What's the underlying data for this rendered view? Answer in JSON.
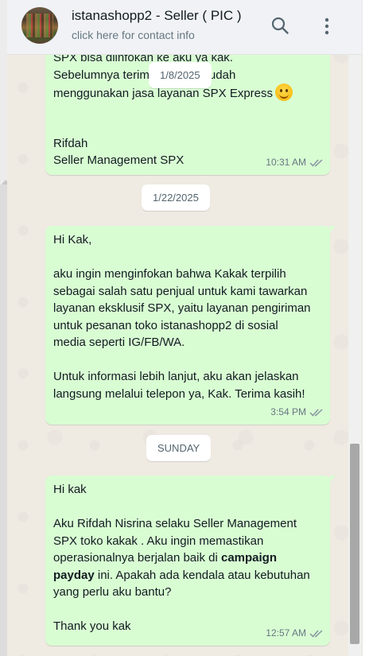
{
  "header": {
    "title": "istanashopp2 - Seller ( PIC )",
    "subtitle": "click here for contact info",
    "icons": [
      "search-icon",
      "menu-icon"
    ]
  },
  "messages": [
    {
      "lines": [
        "SPX bisa diinfokan ke aku ya kak.",
        "Sebelumnya terim        nyak kak sudah",
        "menggunakan jasa layanan SPX Express",
        "",
        "",
        "Rifdah",
        "Seller Management SPX"
      ],
      "time": "10:31 AM"
    },
    {
      "lines": [
        "Hi Kak,",
        "",
        "aku ingin menginfokan bahwa Kakak terpilih",
        "sebagai salah satu penjual untuk kami tawarkan",
        "layanan eksklusif SPX, yaitu layanan pengiriman",
        "untuk pesanan toko istanashopp2  di sosial",
        "media seperti IG/FB/WA.",
        "",
        "Untuk informasi lebih lanjut, aku akan jelaskan",
        "langsung melalui telepon ya, Kak. Terima kasih!"
      ],
      "time": "3:54 PM"
    },
    {
      "lines": [
        "Hi kak",
        "",
        "Aku Rifdah Nisrina selaku Seller Management",
        "SPX toko kakak . Aku ingin memastikan",
        "operasionalnya berjalan baik di ",
        "campaign",
        "payday",
        " ini. Apakah ada kendala atau kebutuhan",
        "yang perlu aku bantu?",
        "",
        "Thank you kak"
      ],
      "time": "12:57 AM"
    }
  ],
  "date_pills": [
    "1/8/2025",
    "1/22/2025",
    "SUNDAY"
  ],
  "colors": {
    "bubble": "#d9fdd3",
    "chat_bg": "#efeae2",
    "header_bg": "#f0f2f5",
    "tick": "#8696a0"
  }
}
